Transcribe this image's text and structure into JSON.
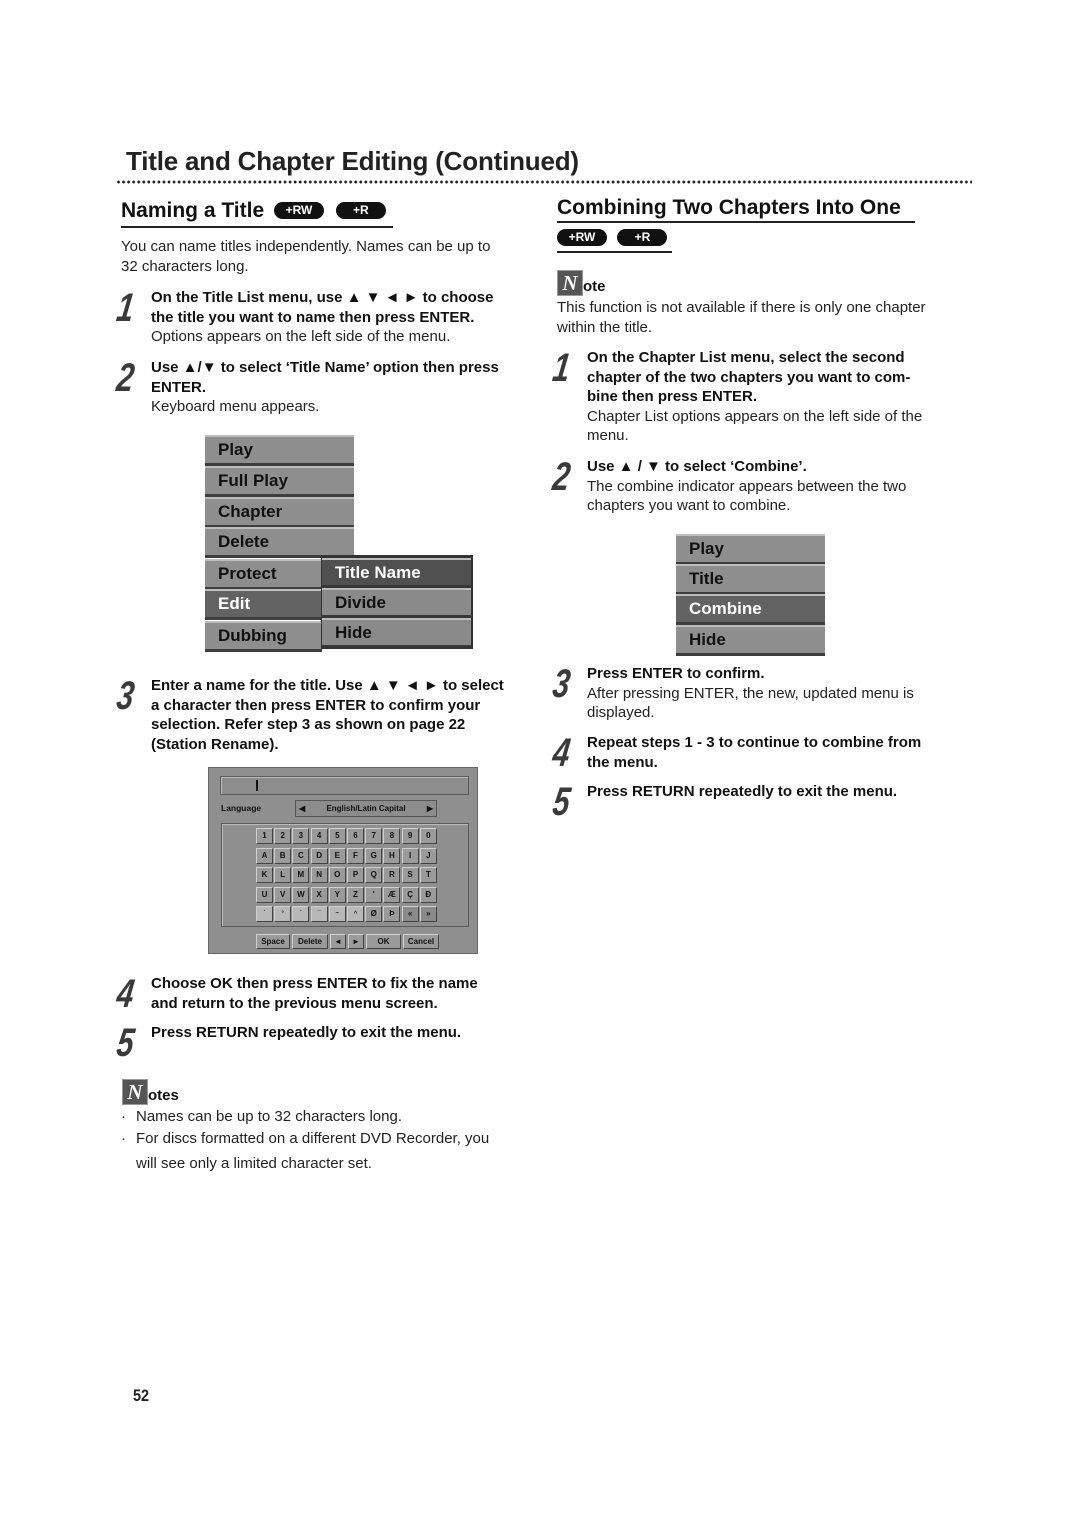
{
  "page": {
    "title": "Title and Chapter Editing (Continued)",
    "page_number": "52"
  },
  "left": {
    "heading": "Naming a Title",
    "badges": [
      "+RW",
      "+R"
    ],
    "intro": [
      "You can name titles independently. Names can be up to",
      "32 characters long."
    ],
    "steps": [
      {
        "num": "1",
        "bold": [
          "On the Title List menu, use ▲ ▼ ◄ ► to choose",
          "the title you want to name then press ENTER."
        ],
        "text": [
          "Options appears on the left side of the menu."
        ]
      },
      {
        "num": "2",
        "bold": [
          "Use ▲/▼ to select ‘Title Name’ option then press",
          "ENTER."
        ],
        "text": [
          "Keyboard menu appears."
        ]
      },
      {
        "num": "3",
        "bold": [
          "Enter a name for the title. Use ▲ ▼ ◄ ► to select",
          "a character then press ENTER to confirm your",
          "selection. Refer step 3 as shown on page 22",
          "(Station Rename)."
        ],
        "text": []
      },
      {
        "num": "4",
        "bold": [
          "Choose OK then press ENTER to fix the name",
          "and return to the previous menu screen."
        ],
        "text": []
      },
      {
        "num": "5",
        "bold": [
          "Press RETURN repeatedly to exit the menu."
        ],
        "text": []
      }
    ],
    "title_menu": {
      "items": [
        "Play",
        "Full Play",
        "Chapter",
        "Delete",
        "Protect",
        "Edit",
        "Dubbing"
      ],
      "selected": "Edit",
      "submenu": [
        "Title Name",
        "Divide",
        "Hide"
      ],
      "submenu_selected": "Title Name"
    },
    "keyboard": {
      "input_value": "",
      "language_label": "Language",
      "language_value": "English/Latin Capital",
      "rows": [
        [
          "1",
          "2",
          "3",
          "4",
          "5",
          "6",
          "7",
          "8",
          "9",
          "0"
        ],
        [
          "A",
          "B",
          "C",
          "D",
          "E",
          "F",
          "G",
          "H",
          "I",
          "J"
        ],
        [
          "K",
          "L",
          "M",
          "N",
          "O",
          "P",
          "Q",
          "R",
          "S",
          "T"
        ],
        [
          "U",
          "V",
          "W",
          "X",
          "Y",
          "Z",
          "'",
          "Æ",
          "Ç",
          "Đ"
        ],
        [
          "`",
          "°",
          "´",
          "¯",
          "~",
          "^",
          "Ø",
          "Þ",
          "«",
          "»"
        ]
      ],
      "buttons": {
        "space": "Space",
        "delete": "Delete",
        "left": "◄",
        "right": "►",
        "ok": "OK",
        "cancel": "Cancel"
      }
    },
    "notes": {
      "icon_letter": "N",
      "label": "otes",
      "items": [
        "Names can be up to 32 characters long.",
        "For discs formatted on a different DVD Recorder, you",
        "will see only a limited character set."
      ]
    }
  },
  "right": {
    "heading": "Combining Two Chapters Into One",
    "badges": [
      "+RW",
      "+R"
    ],
    "note": {
      "icon_letter": "N",
      "label": "ote",
      "text": [
        "This function is not available if there is only one chapter",
        "within the title."
      ]
    },
    "steps": [
      {
        "num": "1",
        "bold": [
          "On the Chapter List menu, select the second",
          "chapter of the two chapters you want to com-",
          "bine then press ENTER."
        ],
        "text": [
          "Chapter List options appears on the left side of the",
          "menu."
        ]
      },
      {
        "num": "2",
        "bold": [
          "Use ▲ / ▼ to select ‘Combine’."
        ],
        "text": [
          "The combine indicator appears between the two",
          "chapters you want to combine."
        ]
      },
      {
        "num": "3",
        "bold": [
          "Press ENTER to confirm."
        ],
        "text": [
          "After pressing ENTER, the new, updated menu is",
          "displayed."
        ]
      },
      {
        "num": "4",
        "bold": [
          "Repeat steps 1 - 3 to continue to combine from",
          "the menu."
        ],
        "text": []
      },
      {
        "num": "5",
        "bold": [
          "Press RETURN repeatedly to exit the menu."
        ],
        "text": []
      }
    ],
    "chapter_menu": {
      "items": [
        "Play",
        "Title",
        "Combine",
        "Hide"
      ],
      "selected": "Combine"
    }
  }
}
